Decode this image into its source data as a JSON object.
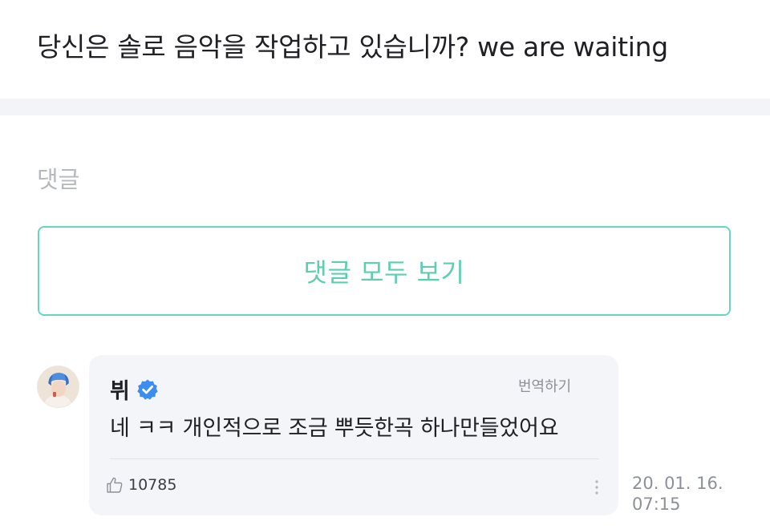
{
  "post": {
    "title": "당신은 솔로 음악을 작업하고 있습니까? we are waiting"
  },
  "comments_section": {
    "label": "댓글",
    "view_all_label": "댓글 모두 보기"
  },
  "comment": {
    "author": "뷔",
    "verified_icon": "verified-badge-icon",
    "translate_label": "번역하기",
    "text": "네 ㅋㅋ 개인적으로 조금 뿌듯한곡 하나만들었어요",
    "like_icon": "thumbs-up-icon",
    "likes": "10785",
    "more_icon": "more-vertical-icon",
    "date_line1": "20. 01. 16.",
    "date_line2": "07:15"
  },
  "colors": {
    "accent": "#5ccfb2",
    "verified": "#3b8ef0"
  }
}
